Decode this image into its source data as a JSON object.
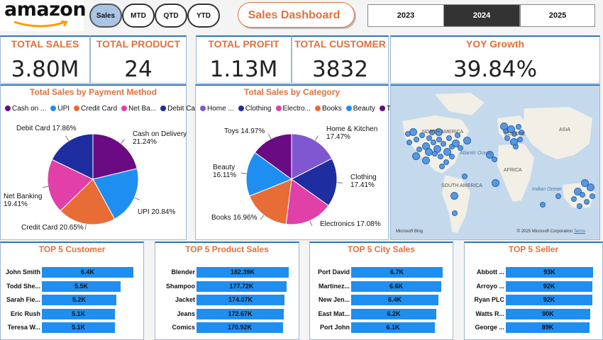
{
  "header": {
    "logo": "amazon",
    "period_buttons": [
      {
        "label": "Sales",
        "active": true
      },
      {
        "label": "MTD",
        "active": false
      },
      {
        "label": "QTD",
        "active": false
      },
      {
        "label": "YTD",
        "active": false
      }
    ],
    "dashboard_title": "Sales Dashboard",
    "years": [
      {
        "label": "2023",
        "active": false
      },
      {
        "label": "2024",
        "active": true
      },
      {
        "label": "2025",
        "active": false
      }
    ]
  },
  "kpis": {
    "total_sales": {
      "title": "TOTAL SALES",
      "value": "3.80M"
    },
    "total_product": {
      "title": "TOTAL PRODUCT",
      "value": "24"
    },
    "total_profit": {
      "title": "TOTAL PROFIT",
      "value": "1.13M"
    },
    "total_customer": {
      "title": "TOTAL CUSTOMER",
      "value": "3832"
    },
    "yoy_growth": {
      "title": "YOY Growth",
      "value": "39.84%"
    }
  },
  "map": {
    "labels": {
      "north_america": "NORTH AMERICA",
      "europe": "EUROPE",
      "asia": "ASIA",
      "africa": "AFRICA",
      "south_america": "SOUTH AMERICA",
      "atlantic": "Atlantic Ocean",
      "indian": "Indian Ocean"
    },
    "attribution": "© 2025 Microsoft Corporation",
    "terms": "Terms",
    "logo": "Microsoft Bing"
  },
  "chart_data": [
    {
      "type": "pie",
      "title": "Total Sales by Payment Method",
      "legend_position": "top",
      "legend": [
        "Cash on ...",
        "UPI",
        "Credit Card",
        "Net Ba...",
        "Debit Card"
      ],
      "categories": [
        "Cash on Delivery",
        "UPI",
        "Credit Card",
        "Net Banking",
        "Debit Card"
      ],
      "values": [
        21.24,
        20.84,
        20.65,
        19.41,
        17.86
      ],
      "labels": [
        "Cash on Delivery 21.24%",
        "UPI 20.84%",
        "Credit Card 20.65%",
        "Net Banking 19.41%",
        "Debit Card 17.86%"
      ],
      "colors": [
        "#6a0b84",
        "#1f8ef1",
        "#e86c36",
        "#e040a8",
        "#1e2da0"
      ]
    },
    {
      "type": "pie",
      "title": "Total Sales by Category",
      "legend_position": "top",
      "legend": [
        "Home ...",
        "Clothing",
        "Electro...",
        "Books",
        "Beauty",
        "Toys"
      ],
      "categories": [
        "Home & Kitchen",
        "Clothing",
        "Electronics",
        "Books",
        "Beauty",
        "Toys"
      ],
      "values": [
        17.47,
        17.41,
        17.08,
        16.96,
        16.11,
        14.97
      ],
      "labels": [
        "Home & Kitchen 17.47%",
        "Clothing 17.41%",
        "Electronics 17.08%",
        "Books 16.96%",
        "Beauty 16.11%",
        "Toys 14.97%"
      ],
      "colors": [
        "#7e57d1",
        "#1e2da0",
        "#e040a8",
        "#e86c36",
        "#1f8ef1",
        "#6a0b84"
      ]
    },
    {
      "type": "bar",
      "title": "TOP 5 Customer",
      "categories": [
        "John Smith",
        "Todd She...",
        "Sarah Fie...",
        "Eric Rush",
        "Teresa W..."
      ],
      "values": [
        6.4,
        5.5,
        5.2,
        5.1,
        5.1
      ],
      "value_labels": [
        "6.4K",
        "5.5K",
        "5.2K",
        "5.1K",
        "5.1K"
      ],
      "xlim": [
        0,
        6.6
      ]
    },
    {
      "type": "bar",
      "title": "TOP 5 Product Sales",
      "categories": [
        "Blender",
        "Shampoo",
        "Jacket",
        "Jeans",
        "Comics"
      ],
      "values": [
        182.39,
        177.72,
        174.07,
        172.67,
        170.92
      ],
      "value_labels": [
        "182.39K",
        "177.72K",
        "174.07K",
        "172.67K",
        "170.92K"
      ],
      "xlim": [
        0,
        188
      ]
    },
    {
      "type": "bar",
      "title": "TOP 5 City Sales",
      "categories": [
        "Port David",
        "Martinez...",
        "New Jen...",
        "East Mat...",
        "Port John"
      ],
      "values": [
        6.7,
        6.6,
        6.4,
        6.2,
        6.1
      ],
      "value_labels": [
        "6.7K",
        "6.6K",
        "6.4K",
        "6.2K",
        "6.1K"
      ],
      "xlim": [
        0,
        6.9
      ]
    },
    {
      "type": "bar",
      "title": "TOP 5 Seller",
      "categories": [
        "Abbott ...",
        "Arroyo ...",
        "Ryan PLC",
        "Watts R...",
        "George ..."
      ],
      "values": [
        93,
        92,
        92,
        90,
        89
      ],
      "value_labels": [
        "93K",
        "92K",
        "92K",
        "90K",
        "89K"
      ],
      "xlim": [
        0,
        95
      ]
    }
  ]
}
